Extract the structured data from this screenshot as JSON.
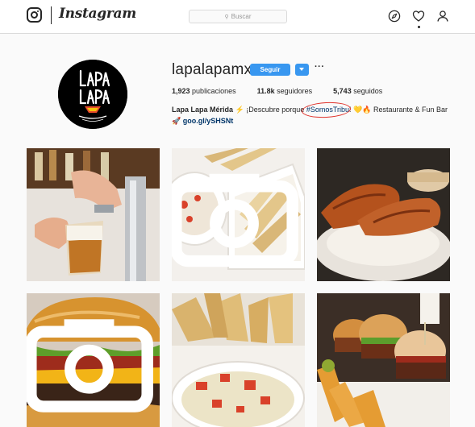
{
  "app": {
    "wordmark": "Instagram"
  },
  "search": {
    "placeholder": "Buscar",
    "icon": "search-icon"
  },
  "nav": {
    "icons": [
      "compass-icon",
      "heart-icon",
      "user-icon"
    ]
  },
  "profile": {
    "username": "lapalapamx",
    "follow_label": "Seguir",
    "more_label": "···",
    "stats": {
      "posts_count": "1,923",
      "posts_label": "publicaciones",
      "followers_count": "11.8k",
      "followers_label": "seguidores",
      "following_count": "5,743",
      "following_label": "seguidos"
    },
    "bio": {
      "name": "Lapa Lapa Mérida",
      "text_before": "¡Descubre porque",
      "hashtag": "#SomosTribu",
      "text_after": "! 💛🔥 Restaurante & Fun Bar",
      "link": "goo.gl/ySHSNt"
    },
    "avatar_logo_text": "Lapa Lapa"
  },
  "posts": [
    {
      "subject": "beer being poured from a tap",
      "is_video": false
    },
    {
      "subject": "dip with pita chips",
      "is_video": true
    },
    {
      "subject": "fried chicken strips over cream sauce",
      "is_video": false
    },
    {
      "subject": "cheeseburger close-up",
      "is_video": true
    },
    {
      "subject": "chips and dip",
      "is_video": false
    },
    {
      "subject": "sliders with fries",
      "is_video": false
    }
  ],
  "colors": {
    "accent": "#3897f0",
    "link": "#003569",
    "annotation_circle": "#e0322b",
    "background": "#fafafa"
  }
}
